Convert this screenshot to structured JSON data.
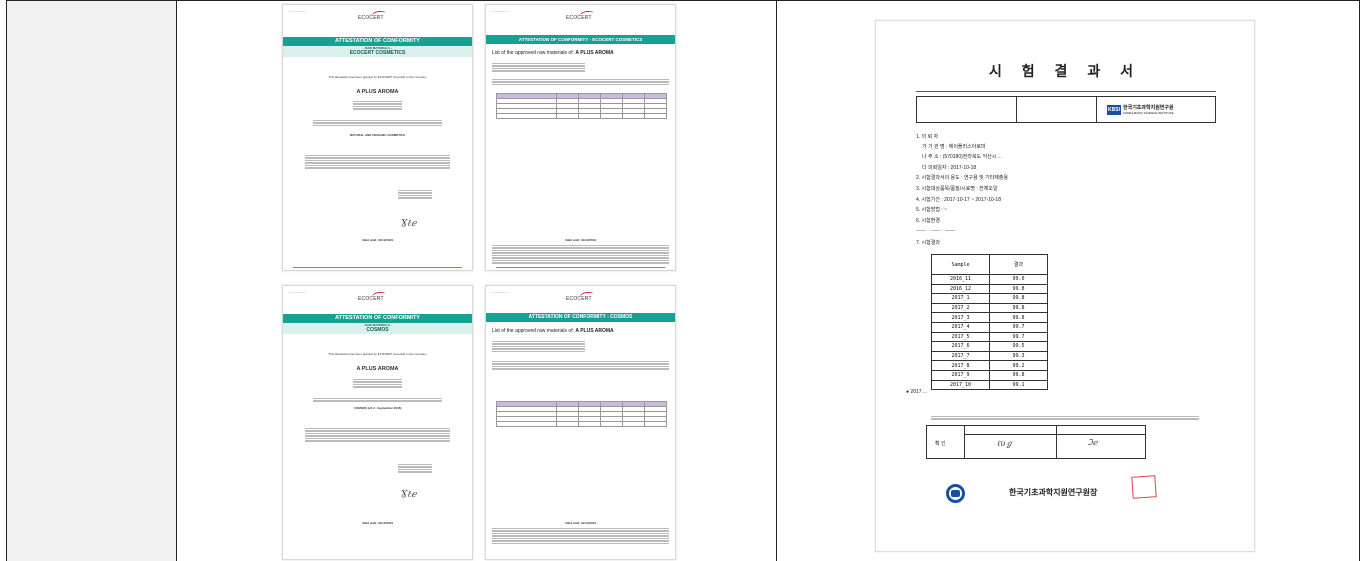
{
  "ecocert": {
    "logo": "ECOCERT",
    "doc1": {
      "banner": "ATTESTATION OF CONFORMITY",
      "sub_small": "- RAW MATERIALS -",
      "sub": "ECOCERT COSMETICS",
      "granted_line": "This attestation has been granted by ECOCERT Greenlife to the company",
      "company": "A PLUS AROMA",
      "standard": "NATURAL AND ORGANIC COSMETICS",
      "valid": "Valid until: 31/12/2019"
    },
    "doc2": {
      "banner": "ATTESTATION OF CONFORMITY - ECOCERT COSMETICS",
      "list_prefix": "List of the approved raw materials of:",
      "list_company": "A PLUS AROMA",
      "valid": "Valid until: 31/12/2019"
    },
    "doc3": {
      "banner": "ATTESTATION OF CONFORMITY",
      "sub_small": "- RAW MATERIALS -",
      "sub": "COSMOS",
      "granted_line": "This attestation has been granted by ECOCERT Greenlife to the company",
      "company": "A PLUS AROMA",
      "standard": "COSMOS (v2.0 - September 2018)",
      "valid": "Valid until: 31/12/2019"
    },
    "doc4": {
      "banner": "ATTESTATION OF CONFORMITY - COSMOS",
      "list_prefix": "List of the approved raw materials of:",
      "list_company": "A PLUS AROMA",
      "valid": "Valid until: 31/12/2019"
    }
  },
  "report": {
    "title": "시 험 결 과 서",
    "institute": "한국기초과학지원연구원",
    "institute_en": "KOREA BASIC SCIENCE INSTITUTE",
    "lines": [
      "1. 의 뢰 자",
      "가 기 관 명 :  에이플러스아로마",
      "나 주    소 :  (570180)전라북도 익산시 ...",
      "다 의뢰일자 :  2017-10-18",
      "2. 시험결과서의 용도 : 연구용 및 기타제출용",
      "3. 시험대상품목/품질/시료명 : 전체오일",
      "4. 시험기간 :   2017-10-17  ~  2017-10-18",
      "5. 시험방법 :  ~",
      "6. 시험환경",
      "7. 시험결과"
    ],
    "table_headers": [
      "Sample",
      "결과"
    ],
    "samples": [
      {
        "name": "2016_11",
        "value": "99.0"
      },
      {
        "name": "2016_12",
        "value": "99.8"
      },
      {
        "name": "2017_1",
        "value": "99.8"
      },
      {
        "name": "2017_2",
        "value": "99.8"
      },
      {
        "name": "2017_3",
        "value": "99.8"
      },
      {
        "name": "2017_4",
        "value": "99.7"
      },
      {
        "name": "2017_5",
        "value": "99.7"
      },
      {
        "name": "2017_6",
        "value": "99.5"
      },
      {
        "name": "2017_7",
        "value": "99.3"
      },
      {
        "name": "2017_8",
        "value": "99.2"
      },
      {
        "name": "2017_9",
        "value": "99.8"
      },
      {
        "name": "2017_10",
        "value": "99.1"
      }
    ],
    "note": "● 2017 ...",
    "confirm_label": "확 인",
    "signatory": "한국기초과학지원연구원장"
  }
}
